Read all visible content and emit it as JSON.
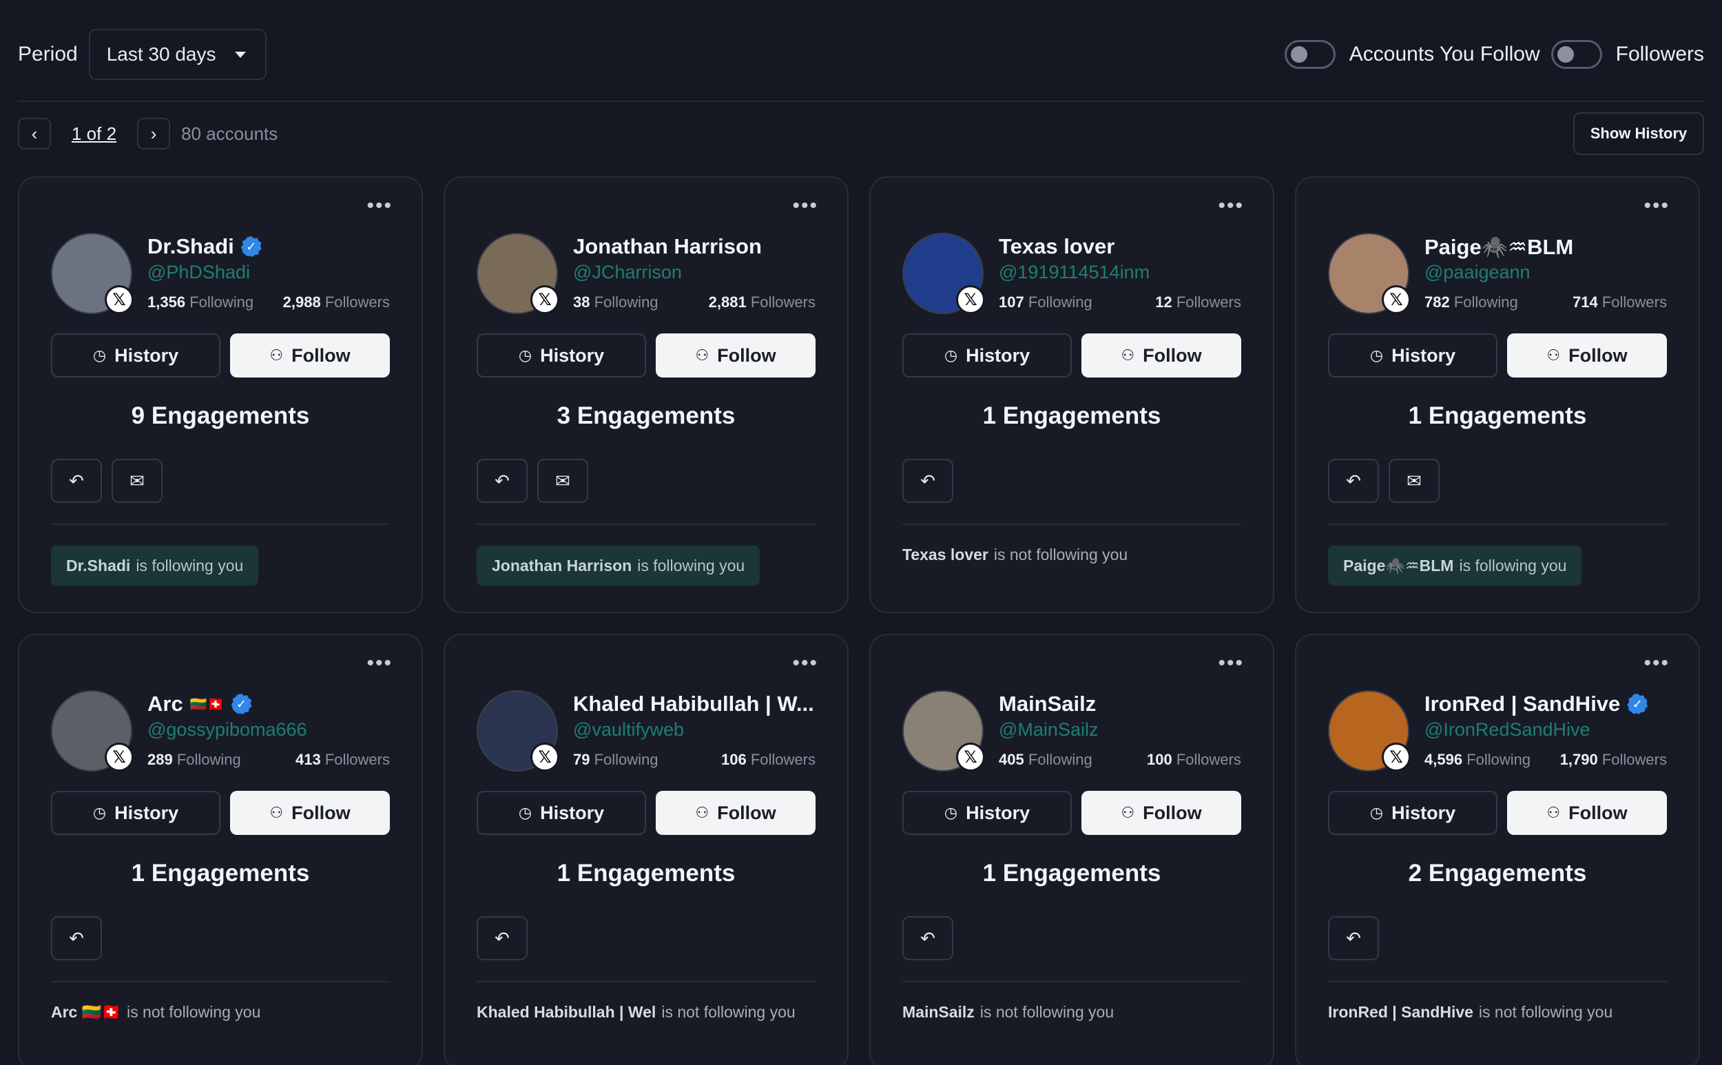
{
  "header": {
    "period_label": "Period",
    "period_value": "Last 30 days",
    "toggle_1_label": "Accounts You Follow",
    "toggle_2_label": "Followers"
  },
  "pager": {
    "page_text": "1 of 2",
    "count_text": "80 accounts",
    "show_history_label": "Show History"
  },
  "labels": {
    "history": "History",
    "follow": "Follow",
    "following_suffix": "Following",
    "followers_suffix": "Followers",
    "is_following": "is following you",
    "not_following": "is not following you"
  },
  "cards": [
    {
      "name": "Dr.Shadi",
      "verified": true,
      "flags": "",
      "handle": "@PhDShadi",
      "following": "1,356",
      "followers": "2,988",
      "engagements": "9 Engagements",
      "dm": true,
      "status_name": "Dr.Shadi",
      "follows_you": true,
      "avatar_color": "#6b7380"
    },
    {
      "name": "Jonathan Harrison",
      "verified": false,
      "flags": "",
      "handle": "@JCharrison",
      "following": "38",
      "followers": "2,881",
      "engagements": "3 Engagements",
      "dm": true,
      "status_name": "Jonathan Harrison",
      "follows_you": true,
      "avatar_color": "#7a6a58"
    },
    {
      "name": "Texas lover",
      "verified": false,
      "flags": "",
      "handle": "@1919114514inm",
      "following": "107",
      "followers": "12",
      "engagements": "1 Engagements",
      "dm": false,
      "status_name": "Texas lover",
      "follows_you": false,
      "avatar_color": "#1f3d8a"
    },
    {
      "name": "Paige🕷️♒BLM",
      "verified": false,
      "flags": "",
      "handle": "@paaigeann",
      "following": "782",
      "followers": "714",
      "engagements": "1 Engagements",
      "dm": true,
      "status_name": "Paige🕷️♒BLM",
      "follows_you": true,
      "avatar_color": "#a8836a"
    },
    {
      "name": "Arc",
      "verified": true,
      "flags": "🇱🇹🇨🇭",
      "handle": "@gossypiboma666",
      "following": "289",
      "followers": "413",
      "engagements": "1 Engagements",
      "dm": false,
      "status_name": "Arc 🇱🇹🇨🇭",
      "follows_you": false,
      "avatar_color": "#5c5f66"
    },
    {
      "name": "Khaled Habibullah | W...",
      "verified": false,
      "flags": "",
      "handle": "@vaultifyweb",
      "following": "79",
      "followers": "106",
      "engagements": "1 Engagements",
      "dm": false,
      "status_name": "Khaled Habibullah | Wel",
      "follows_you": false,
      "avatar_color": "#2a3450"
    },
    {
      "name": "MainSailz",
      "verified": false,
      "flags": "",
      "handle": "@MainSailz",
      "following": "405",
      "followers": "100",
      "engagements": "1 Engagements",
      "dm": false,
      "status_name": "MainSailz",
      "follows_you": false,
      "avatar_color": "#8a8175"
    },
    {
      "name": "IronRed | SandHive",
      "verified": true,
      "flags": "",
      "handle": "@IronRedSandHive",
      "following": "4,596",
      "followers": "1,790",
      "engagements": "2 Engagements",
      "dm": false,
      "status_name": "IronRed | SandHive",
      "follows_you": false,
      "avatar_color": "#b8651f"
    }
  ],
  "icons": {
    "more": "ellipsis-icon",
    "history": "clock-icon",
    "follow": "user-plus-icon",
    "reply": "reply-icon",
    "dm": "envelope-icon",
    "platform": "x-logo-icon",
    "verified": "verified-badge-icon"
  }
}
